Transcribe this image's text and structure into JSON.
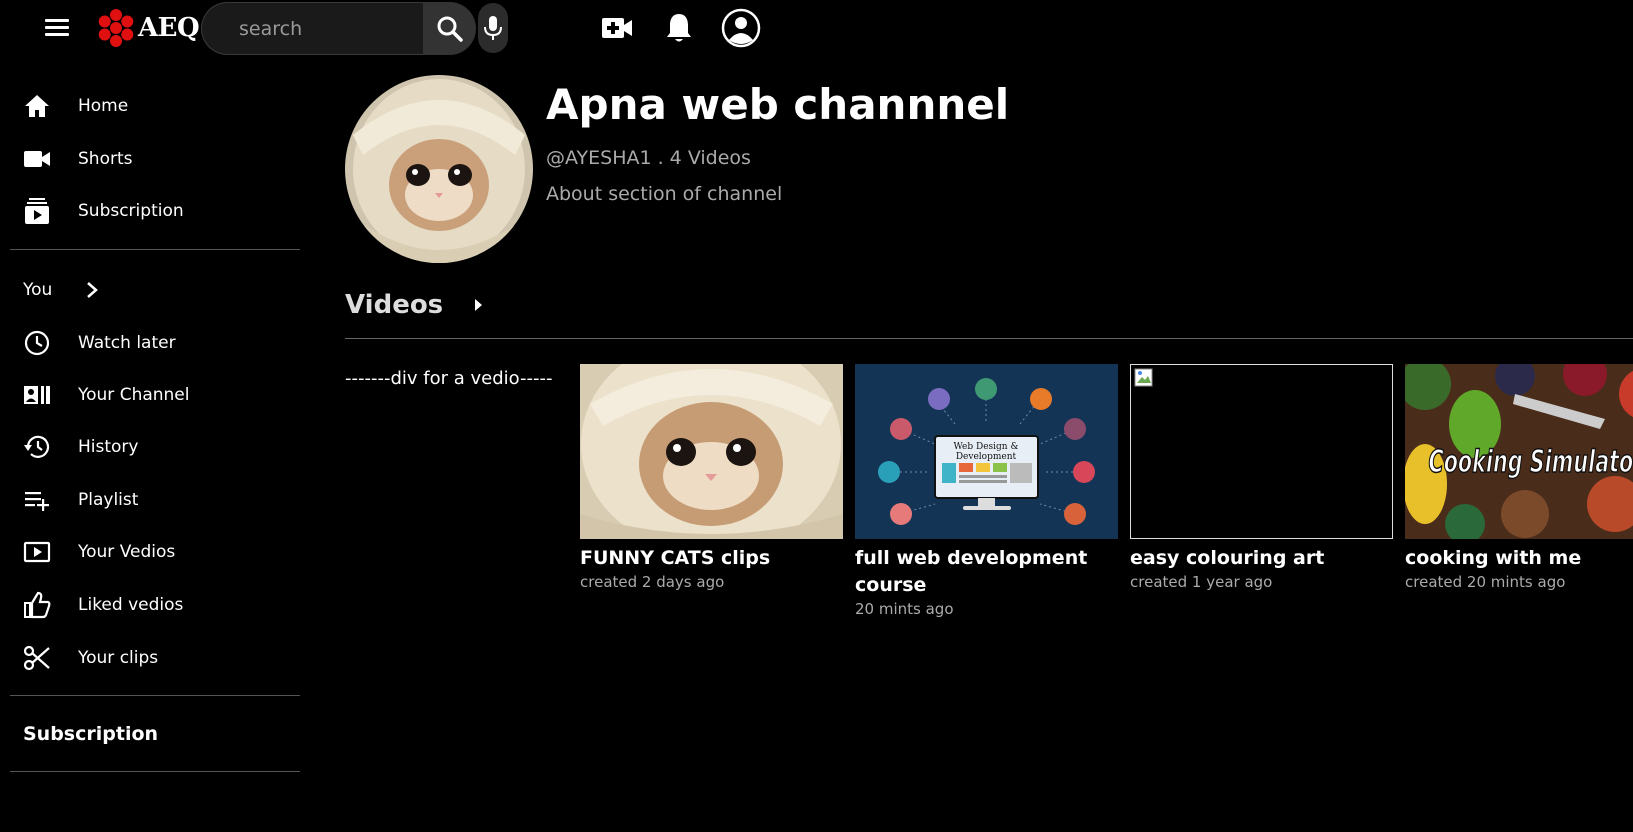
{
  "header": {
    "logo_text": "AEQ",
    "search_placeholder": "search",
    "icons": [
      "menu-icon",
      "search-icon",
      "mic-icon",
      "create-video-icon",
      "bell-icon",
      "account-icon"
    ]
  },
  "sidebar": {
    "main": [
      {
        "label": "Home",
        "icon": "home-icon"
      },
      {
        "label": "Shorts",
        "icon": "shorts-icon"
      },
      {
        "label": "Subscription",
        "icon": "subscription-icon"
      }
    ],
    "you_label": "You",
    "you_items": [
      {
        "label": "Watch later",
        "icon": "clock-icon"
      },
      {
        "label": "Your Channel",
        "icon": "channel-icon"
      },
      {
        "label": "History",
        "icon": "history-icon"
      },
      {
        "label": "Playlist",
        "icon": "playlist-add-icon"
      },
      {
        "label": "Your Vedios",
        "icon": "video-icon"
      },
      {
        "label": "Liked vedios",
        "icon": "thumbs-up-icon"
      },
      {
        "label": "Your clips",
        "icon": "scissors-icon"
      }
    ],
    "subscription_heading": "Subscription"
  },
  "channel": {
    "name": "Apna web channnel",
    "meta": "@AYESHA1 . 4 Videos",
    "about": "About section of channel"
  },
  "videos_section": {
    "heading": "Videos",
    "note": "-------div for a vedio-----",
    "cards": [
      {
        "title": "FUNNY CATS clips",
        "sub": "created 2 days ago",
        "thumb": "cat"
      },
      {
        "title": "full web development course",
        "sub": "20 mints ago",
        "thumb": "webdev",
        "thumb_text": [
          "Web Design &",
          "Development"
        ]
      },
      {
        "title": "easy colouring art",
        "sub": "created 1 year ago",
        "thumb": "broken"
      },
      {
        "title": "cooking with me",
        "sub": "created 20 mints ago",
        "thumb": "cooking",
        "thumb_text": [
          "Cooking Simulator"
        ]
      }
    ]
  },
  "colors": {
    "background": "#000000",
    "logo_red": "#e01010",
    "muted_text": "#aaaaaa"
  }
}
